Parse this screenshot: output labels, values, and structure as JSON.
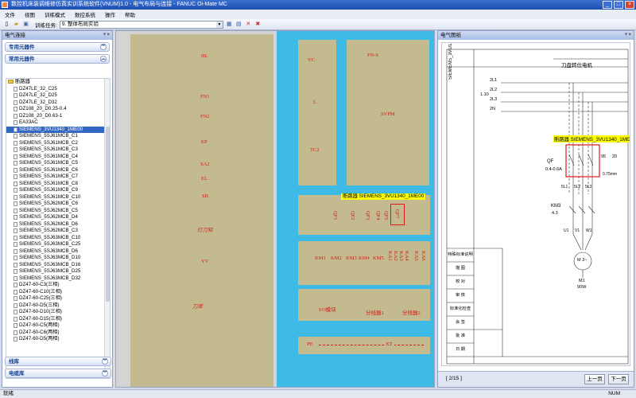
{
  "window": {
    "title": "数控机床装调维修仿真实训系统软件(VNUM)1.0 - 电气布局与连接 - FANUC Oi-Mate MC",
    "minimize": "_",
    "maximize": "□",
    "close": "×"
  },
  "menu": [
    "文件",
    "视图",
    "训练模式",
    "数控系统",
    "操作",
    "帮助"
  ],
  "toolbar": {
    "task_label": "训练任务:",
    "task_value": "9. 整体布局实验"
  },
  "left_panel": {
    "title": "电气连接",
    "pin": "ᵠ ×",
    "groups": {
      "special": "专用元器件",
      "common": "常用元器件",
      "wire": "线库",
      "cable": "电缆库"
    },
    "tree_root": "断路器",
    "tree_items": [
      "DZ47LE_32_C25",
      "DZ47LE_32_D25",
      "DZ47LE_32_D32",
      "DZ108_20_D0.25-0.4",
      "DZ108_20_D0.63-1",
      "EA33AC",
      "SIEMENS_3VU1340_1ME00",
      "SIEMENS_5SJ61MCB_C1",
      "SIEMENS_5SJ61MCB_C2",
      "SIEMENS_5SJ61MCB_C3",
      "SIEMENS_5SJ61MCB_C4",
      "SIEMENS_5SJ61MCB_C5",
      "SIEMENS_5SJ61MCB_C6",
      "SIEMENS_5SJ61MCB_C7",
      "SIEMENS_5SJ61MCB_C8",
      "SIEMENS_5SJ61MCB_C9",
      "SIEMENS_5SJ61MCB_C10",
      "SIEMENS_5SJ62MCB_C6",
      "SIEMENS_5SJ62MCB_C5",
      "SIEMENS_5SJ62MCB_D4",
      "SIEMENS_5SJ62MCB_D6",
      "SIEMENS_5SJ62MCB_C3",
      "SIEMENS_5SJ63MCB_C10",
      "SIEMENS_5SJ63MCB_C25",
      "SIEMENS_5SJ63MCB_D6",
      "SIEMENS_5SJ63MCB_D10",
      "SIEMENS_5SJ63MCB_D16",
      "SIEMENS_5SJ63MCB_D25",
      "SIEMENS_5SJ63MCB_D32",
      "DZ47-60-C3(三相)",
      "DZ47-60-C10(三相)",
      "DZ47-60-C25(三相)",
      "DZ47-60-D5(三相)",
      "DZ47-60-D10(三相)",
      "DZ47-60-D15(三相)",
      "DZ47-60-C5(两相)",
      "DZ47-60-C6(两相)",
      "DZ47-60-D5(两相)"
    ],
    "selected_index": 6
  },
  "canvas": {
    "labels_left": [
      "HL",
      "FN1",
      "FN2",
      "EP",
      "SA2",
      "EL",
      "SB",
      "灯刀知",
      "YV",
      "刀库"
    ],
    "top_right_labels": [
      "VC",
      "L",
      "TC2",
      "FN-S",
      "SVPM"
    ],
    "breaker_tag": "断路器 SIEMENS_3VU1340_1ME00",
    "qf_labels": [
      "QF1",
      "QF2",
      "QF3",
      "QF4",
      "QF5",
      "QF7"
    ],
    "km_labels": [
      "KM1",
      "KM2",
      "KM3",
      "KM4",
      "KM5"
    ],
    "ka_labels": [
      "KA1",
      "KA2",
      "KA3",
      "KA4",
      "KA5",
      "KA6"
    ],
    "io_labels": [
      "I/O模块",
      "分线器1",
      "分线器2"
    ],
    "pe": "PE",
    "xt": "XT"
  },
  "right_panel": {
    "title": "电气图纸",
    "pin": "ᵠ ×",
    "drawing": {
      "top_caption": "刀盘转位电机",
      "side_caption": "SIEMENS_3VU1340_1ME00",
      "bus_labels": [
        "2L1",
        "2L2",
        "2L3",
        "2N"
      ],
      "bus_ref": "1.10",
      "breaker_tag": "断路器 SIEMENS_3VU1340_1ME00",
      "qf_label": "QF",
      "qf_range": "0.4-0.6A",
      "rating_1": "95",
      "rating_2": "20",
      "rating_3": "0.75mm",
      "km_label": "KM3",
      "km_ref": "4.3",
      "phase_labels": [
        "5L1",
        "5L2",
        "5L3"
      ],
      "terminal_labels": [
        "U1",
        "V1",
        "W1"
      ],
      "motor_label": "M1",
      "motor_power": "90W",
      "motor_symbol": "M 3~",
      "table_rows": [
        "特殊标准说明",
        "描  图",
        "校  对",
        "审  核",
        "标准化检查",
        "会  签",
        "批  准",
        "日  期"
      ]
    },
    "page_indicator": "[ 2/15 ]",
    "prev_button": "上一页",
    "next_button": "下一页"
  },
  "statusbar": {
    "text": "就绪",
    "num": "NUM"
  }
}
